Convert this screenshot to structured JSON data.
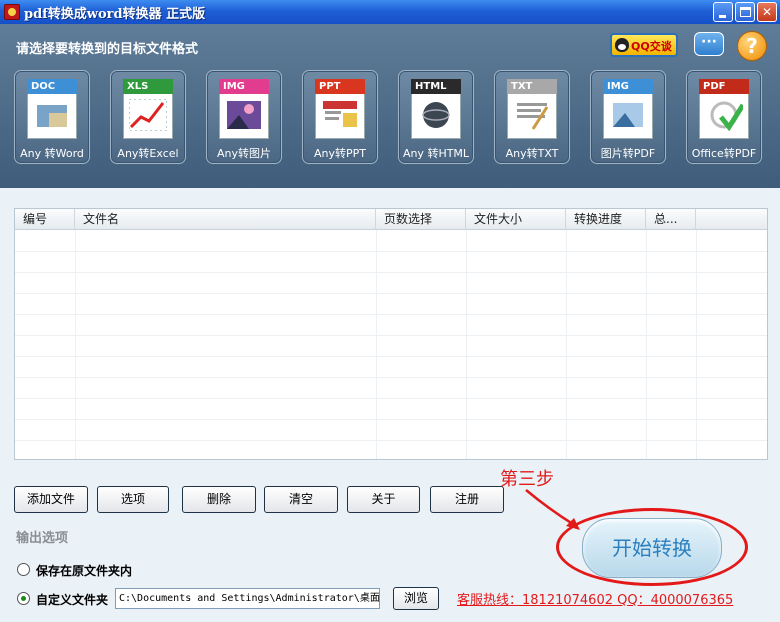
{
  "window": {
    "title": "pdf转换成word转换器 正式版"
  },
  "header": {
    "prompt": "请选择要转换到的目标文件格式",
    "qq_button": "QQ交谈",
    "chat_icon": "chat-bubble-icon",
    "help_icon": "help-icon",
    "help_glyph": "?"
  },
  "formats": [
    {
      "tag": "DOC",
      "caption": "Any 转Word",
      "color": "#3d8fd6"
    },
    {
      "tag": "XLS",
      "caption": "Any转Excel",
      "color": "#2e9a3c"
    },
    {
      "tag": "IMG",
      "caption": "Any转图片",
      "color": "#e23c8e"
    },
    {
      "tag": "PPT",
      "caption": "Any转PPT",
      "color": "#d9361f"
    },
    {
      "tag": "HTML",
      "caption": "Any 转HTML",
      "color": "#2a2a2a"
    },
    {
      "tag": "TXT",
      "caption": "Any转TXT",
      "color": "#a8a8a8"
    },
    {
      "tag": "IMG",
      "caption": "图片转PDF",
      "color": "#3d8fd6"
    },
    {
      "tag": "PDF",
      "caption": "Office转PDF",
      "color": "#c22a1a"
    }
  ],
  "table": {
    "columns": [
      "编号",
      "文件名",
      "页数选择",
      "文件大小",
      "转换进度",
      "总..."
    ],
    "rows": []
  },
  "buttons": {
    "add": "添加文件",
    "options": "选项",
    "delete": "删除",
    "clear": "清空",
    "about": "关于",
    "register": "注册"
  },
  "step_label": "第三步",
  "start_button": "开始转换",
  "output": {
    "title": "输出选项",
    "option_original": "保存在原文件夹内",
    "option_custom": "自定义文件夹",
    "selected": "custom",
    "path_value": "C:\\Documents and Settings\\Administrator\\桌面",
    "browse": "浏览"
  },
  "hotline": "客服热线：18121074602 QQ：4000076365",
  "colors": {
    "accent_red": "#e21a1a",
    "header_bg": "#4f6d8b",
    "start_text": "#2b7fbf"
  }
}
